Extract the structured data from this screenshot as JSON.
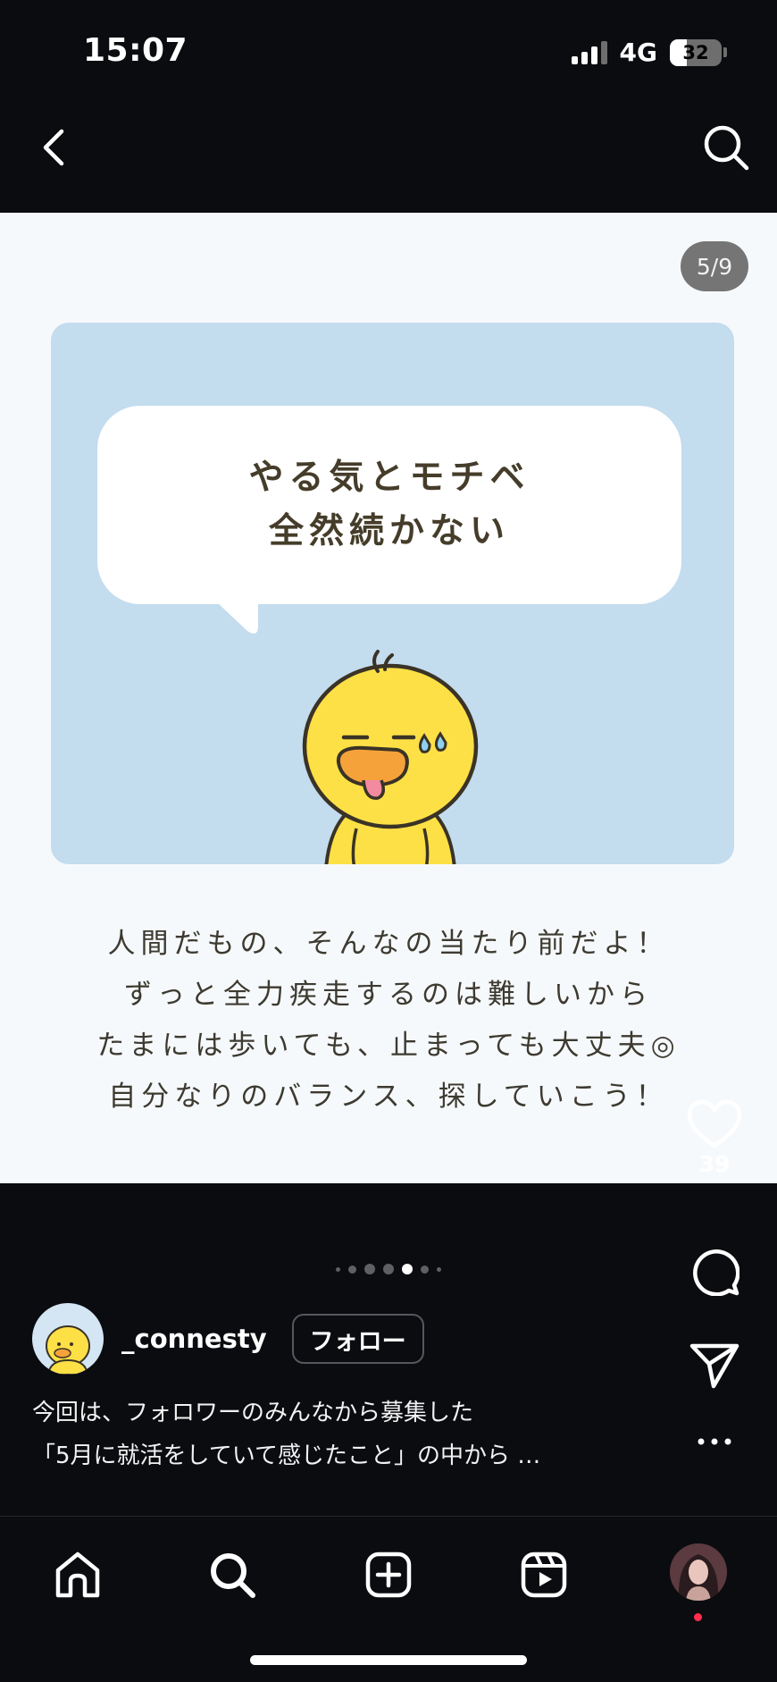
{
  "status_bar": {
    "time": "15:07",
    "network": "4G",
    "battery_level": "32"
  },
  "post": {
    "page_counter": "5/9",
    "speech_bubble": [
      "やる気とモチベ",
      "全然続かない"
    ],
    "message_lines": [
      "人間だもの、そんなの当たり前だよ！",
      "ずっと全力疾走するのは難しいから",
      "たまには歩いても、止まっても大丈夫◎",
      "自分なりのバランス、探していこう！"
    ],
    "carousel": {
      "total_visible_dots": 7,
      "active_index": 4
    }
  },
  "actions": {
    "like_count": "39"
  },
  "author": {
    "username": "_connesty",
    "follow_label": "フォロー"
  },
  "caption": {
    "line1": "今回は、フォロワーのみんなから募集した",
    "line2": "「5月に就活をしていて感じたこと」の中から …"
  },
  "icons": {
    "back": "back-chevron-icon",
    "search": "search-icon",
    "like": "heart-icon",
    "comment": "comment-icon",
    "share": "send-icon",
    "more": "more-icon",
    "home": "home-icon",
    "explore": "search-icon",
    "create": "plus-square-icon",
    "reels": "reels-icon"
  },
  "colors": {
    "background": "#0b0c10",
    "card_blue": "#c3dcee",
    "chick_yellow": "#fde046",
    "text_brown": "#453d2a",
    "notify_red": "#ff2d4d"
  }
}
